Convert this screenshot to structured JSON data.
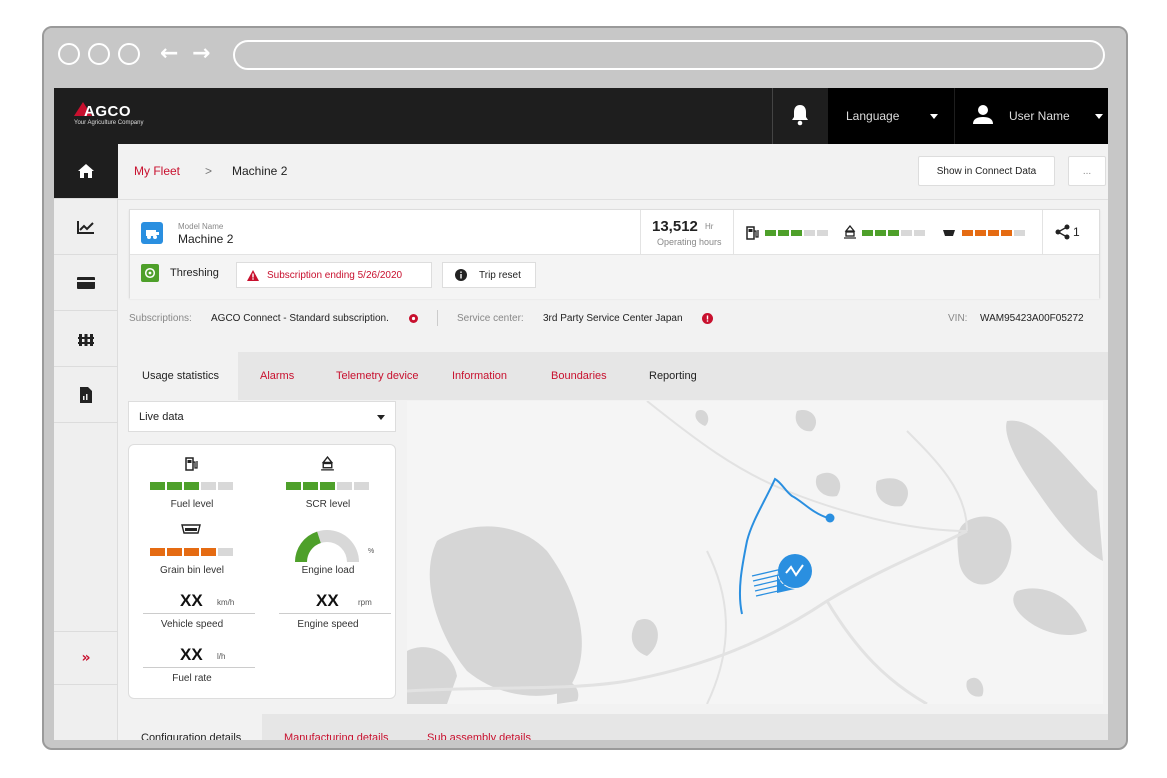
{
  "brand": {
    "name": "AGCO",
    "tagline": "Your Agriculture Company",
    "accent": "#c8102e"
  },
  "header": {
    "language_label": "Language",
    "user_label": "User Name"
  },
  "breadcrumb": {
    "fleet": "My Fleet",
    "separator": ">",
    "machine": "Machine 2"
  },
  "actions": {
    "show_connect": "Show in Connect Data",
    "more": "..."
  },
  "machine": {
    "model_label": "Model Name",
    "model_name": "Machine 2",
    "hours_value": "13,512",
    "hours_unit": "Hr",
    "hours_label": "Operating hours",
    "share_count": "1",
    "status_label": "Threshing",
    "subscription_alert": "Subscription ending 5/26/2020",
    "trip_reset": "Trip reset"
  },
  "info_row": {
    "subscriptions_label": "Subscriptions:",
    "subscriptions_value": "AGCO Connect - Standard subscription.",
    "service_label": "Service center:",
    "service_value": "3rd Party Service Center Japan",
    "vin_label": "VIN:",
    "vin_value": "WAM95423A00F05272"
  },
  "tabs": [
    "Usage statistics",
    "Alarms",
    "Telemetry device",
    "Information",
    "Boundaries",
    "Reporting"
  ],
  "live": {
    "dropdown": "Live data",
    "fuel_label": "Fuel level",
    "scr_label": "SCR level",
    "grain_label": "Grain bin level",
    "engine_load_label": "Engine load",
    "engine_load_unit": "%",
    "vehicle_speed_value": "XX",
    "vehicle_speed_unit": "km/h",
    "vehicle_speed_label": "Vehicle speed",
    "engine_speed_value": "XX",
    "engine_speed_unit": "rpm",
    "engine_speed_label": "Engine speed",
    "fuel_rate_value": "XX",
    "fuel_rate_unit": "l/h",
    "fuel_rate_label": "Fuel rate"
  },
  "levels": {
    "fuel": 0.6,
    "scr": 0.6,
    "grain": 0.8,
    "engine_load": 0.4
  },
  "bottom_tabs": [
    "Configuration details",
    "Manufacturing details",
    "Sub assembly details"
  ]
}
